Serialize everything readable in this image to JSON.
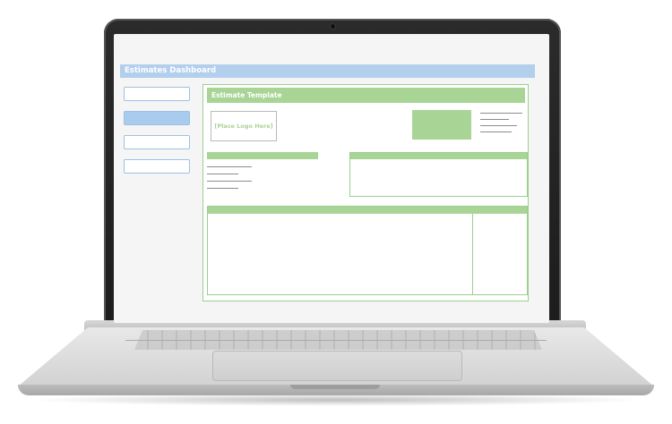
{
  "app": {
    "title": "Estimates Dashboard"
  },
  "sidebar": {
    "items": [
      {
        "id": "nav-1",
        "active": false
      },
      {
        "id": "nav-2",
        "active": true
      },
      {
        "id": "nav-3",
        "active": false
      },
      {
        "id": "nav-4",
        "active": false
      }
    ]
  },
  "template": {
    "title": "Estimate Template",
    "logo_placeholder": "[Place Logo Here]"
  },
  "colors": {
    "header_blue": "#b3cfee",
    "nav_active": "#a9cbee",
    "template_green": "#a8d495",
    "border_green": "#9ccf8e"
  },
  "icons": [
    "webcam-icon"
  ]
}
